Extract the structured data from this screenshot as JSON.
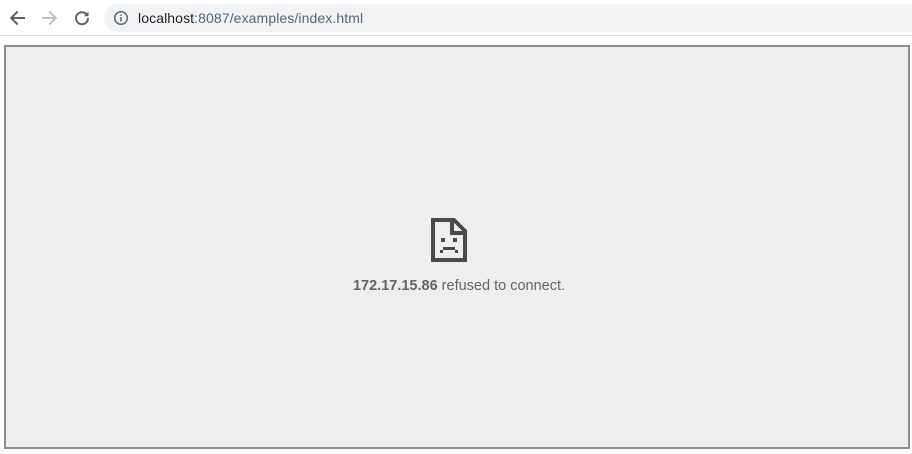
{
  "browser": {
    "nav": {
      "back_icon": "arrow-left-icon",
      "forward_icon": "arrow-right-icon",
      "reload_icon": "reload-icon"
    },
    "omnibox": {
      "info_icon": "info-circle-icon",
      "url_host": "localhost",
      "url_rest": ":8087/examples/index.html"
    }
  },
  "page": {
    "error_icon": "sad-page-icon",
    "error_host": "172.17.15.86",
    "error_message": " refused to connect."
  },
  "colors": {
    "page_background": "#eeeeee",
    "error_text": "#646464",
    "icon": "#5f6368",
    "icon_disabled": "#bdc1c6"
  }
}
